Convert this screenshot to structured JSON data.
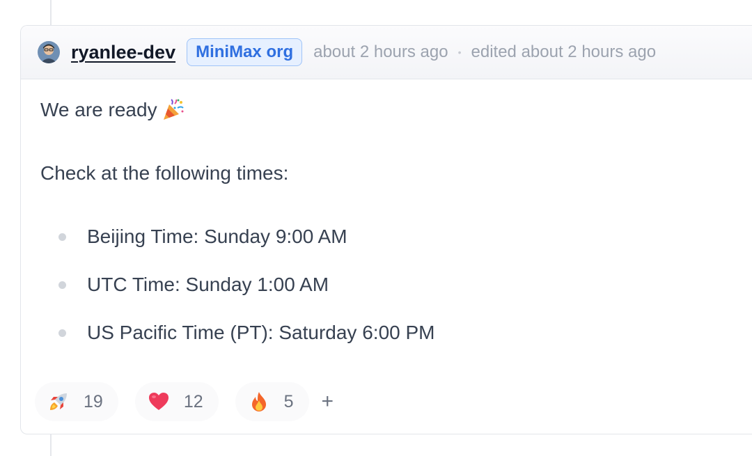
{
  "comment": {
    "author": "ryanlee-dev",
    "org_badge": "MiniMax org",
    "created": "about 2 hours ago",
    "separator": "•",
    "edited": "edited about 2 hours ago",
    "body": {
      "line1": "We are ready",
      "line1_icon": "party-popper-icon",
      "line2": "Check at the following times:",
      "times": [
        "Beijing Time: Sunday 9:00 AM",
        "UTC Time: Sunday 1:00 AM",
        "US Pacific Time (PT): Saturday 6:00 PM"
      ]
    },
    "reactions": [
      {
        "icon": "rocket-icon",
        "count": "19"
      },
      {
        "icon": "heart-icon",
        "count": "12"
      },
      {
        "icon": "fire-icon",
        "count": "5"
      }
    ],
    "add_reaction_label": "+"
  },
  "colors": {
    "badge_text": "#2f6fe0",
    "badge_bg": "#e6f0ff",
    "text": "#374151",
    "muted": "#9ca3af"
  }
}
